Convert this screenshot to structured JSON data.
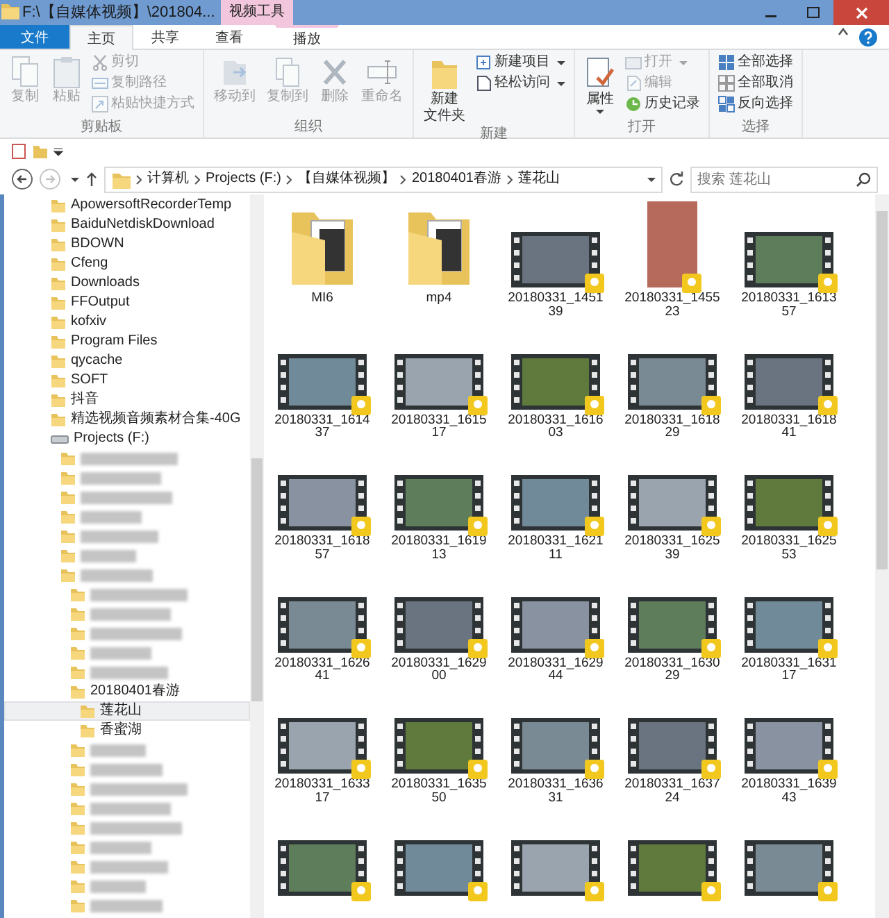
{
  "window": {
    "title": "F:\\【自媒体视频】\\201804...",
    "context_group": "视频工具"
  },
  "ribbon_tabs": [
    {
      "label": "文件",
      "kind": "file",
      "selected": false
    },
    {
      "label": "主页",
      "kind": "tab",
      "selected": true
    },
    {
      "label": "共享",
      "kind": "tab",
      "selected": false
    },
    {
      "label": "查看",
      "kind": "tab",
      "selected": false
    },
    {
      "label": "播放",
      "kind": "context",
      "selected": false
    }
  ],
  "ribbon_groups": [
    {
      "label": "剪贴板",
      "items": [
        {
          "label": "复制",
          "kind": "large",
          "disabled": true
        },
        {
          "label": "粘贴",
          "kind": "large",
          "disabled": true
        },
        {
          "label": "剪切",
          "kind": "small",
          "disabled": true
        },
        {
          "label": "复制路径",
          "kind": "small",
          "disabled": true
        },
        {
          "label": "粘贴快捷方式",
          "kind": "small",
          "disabled": true
        }
      ]
    },
    {
      "label": "组织",
      "items": [
        {
          "label": "移动到",
          "kind": "large",
          "disabled": true
        },
        {
          "label": "复制到",
          "kind": "large",
          "disabled": true
        },
        {
          "label": "删除",
          "kind": "large",
          "disabled": true
        },
        {
          "label": "重命名",
          "kind": "large",
          "disabled": true
        }
      ]
    },
    {
      "label": "新建",
      "items": [
        {
          "label_lines": [
            "新建",
            "文件夹"
          ],
          "kind": "large",
          "disabled": false
        },
        {
          "label": "新建项目",
          "kind": "small",
          "dropdown": true,
          "disabled": false
        },
        {
          "label": "轻松访问",
          "kind": "small",
          "dropdown": true,
          "disabled": false
        }
      ]
    },
    {
      "label": "打开",
      "items": [
        {
          "label": "属性",
          "kind": "large",
          "dropdown": true,
          "disabled": false
        },
        {
          "label": "打开",
          "kind": "small",
          "dropdown": true,
          "disabled": true
        },
        {
          "label": "编辑",
          "kind": "small",
          "disabled": true
        },
        {
          "label": "历史记录",
          "kind": "small",
          "disabled": false
        }
      ]
    },
    {
      "label": "选择",
      "items": [
        {
          "label": "全部选择",
          "kind": "small",
          "disabled": false
        },
        {
          "label": "全部取消",
          "kind": "small",
          "disabled": false
        },
        {
          "label": "反向选择",
          "kind": "small",
          "disabled": false
        }
      ]
    }
  ],
  "address_bar": {
    "breadcrumb": [
      "计算机",
      "Projects (F:)",
      "【自媒体视频】",
      "20180401春游",
      "莲花山"
    ],
    "forward_disabled": true
  },
  "search": {
    "placeholder": "搜索 莲花山"
  },
  "nav_tree": [
    {
      "name": "ApowersoftRecorderTemp",
      "selected": false
    },
    {
      "name": "BaiduNetdiskDownload",
      "selected": false
    },
    {
      "name": "BDOWN",
      "selected": false
    },
    {
      "name": "Cfeng",
      "selected": false
    },
    {
      "name": "Downloads",
      "selected": false
    },
    {
      "name": "FFOutput",
      "selected": false
    },
    {
      "name": "kofxiv",
      "selected": false
    },
    {
      "name": "Program Files",
      "selected": false
    },
    {
      "name": "qycache",
      "selected": false
    },
    {
      "name": "SOFT",
      "selected": false
    },
    {
      "name": "抖音",
      "selected": false
    },
    {
      "name": "精选视频音频素材合集-40G",
      "selected": false
    },
    {
      "name": "Projects (F:)",
      "kind": "drive",
      "selected": false,
      "children": [
        {
          "redacted": true,
          "selected": false
        },
        {
          "redacted": true,
          "selected": false
        },
        {
          "redacted": true,
          "selected": false
        },
        {
          "redacted": true,
          "selected": false
        },
        {
          "redacted": true,
          "selected": false
        },
        {
          "redacted": true,
          "selected": false
        },
        {
          "redacted": true,
          "selected": false,
          "children": [
            {
              "redacted": true,
              "selected": false
            },
            {
              "redacted": true,
              "selected": false
            },
            {
              "redacted": true,
              "selected": false
            },
            {
              "redacted": true,
              "selected": false
            },
            {
              "redacted": true,
              "selected": false
            },
            {
              "name": "20180401春游",
              "selected": false,
              "children": [
                {
                  "name": "莲花山",
                  "selected": true
                },
                {
                  "name": "香蜜湖",
                  "selected": false
                }
              ]
            },
            {
              "redacted": true,
              "selected": false
            },
            {
              "redacted": true,
              "selected": false
            },
            {
              "redacted": true,
              "selected": false
            },
            {
              "redacted": true,
              "selected": false
            },
            {
              "redacted": true,
              "selected": false
            },
            {
              "redacted": true,
              "selected": false
            },
            {
              "redacted": true,
              "selected": false
            },
            {
              "redacted": true,
              "selected": false
            },
            {
              "redacted": true,
              "selected": false
            }
          ]
        }
      ]
    }
  ],
  "files": [
    {
      "name": "MI6",
      "kind": "folder"
    },
    {
      "name": "mp4",
      "kind": "folder"
    },
    {
      "name": "20180331_145139",
      "kind": "video"
    },
    {
      "name": "20180331_145523",
      "kind": "portrait"
    },
    {
      "name": "20180331_161357",
      "kind": "video"
    },
    {
      "name": "20180331_161437",
      "kind": "video"
    },
    {
      "name": "20180331_161517",
      "kind": "video"
    },
    {
      "name": "20180331_161603",
      "kind": "video"
    },
    {
      "name": "20180331_161829",
      "kind": "video"
    },
    {
      "name": "20180331_161841",
      "kind": "video"
    },
    {
      "name": "20180331_161857",
      "kind": "video"
    },
    {
      "name": "20180331_161913",
      "kind": "video"
    },
    {
      "name": "20180331_162111",
      "kind": "video"
    },
    {
      "name": "20180331_162539",
      "kind": "video"
    },
    {
      "name": "20180331_162553",
      "kind": "video"
    },
    {
      "name": "20180331_162641",
      "kind": "video"
    },
    {
      "name": "20180331_162900",
      "kind": "video"
    },
    {
      "name": "20180331_162944",
      "kind": "video"
    },
    {
      "name": "20180331_163029",
      "kind": "video"
    },
    {
      "name": "20180331_163117",
      "kind": "video"
    },
    {
      "name": "20180331_163317",
      "kind": "video"
    },
    {
      "name": "20180331_163550",
      "kind": "video"
    },
    {
      "name": "20180331_163631",
      "kind": "video"
    },
    {
      "name": "20180331_163724",
      "kind": "video"
    },
    {
      "name": "20180331_163943",
      "kind": "video"
    },
    {
      "kind": "video"
    },
    {
      "kind": "video"
    },
    {
      "kind": "video"
    },
    {
      "kind": "video"
    },
    {
      "kind": "video"
    }
  ]
}
